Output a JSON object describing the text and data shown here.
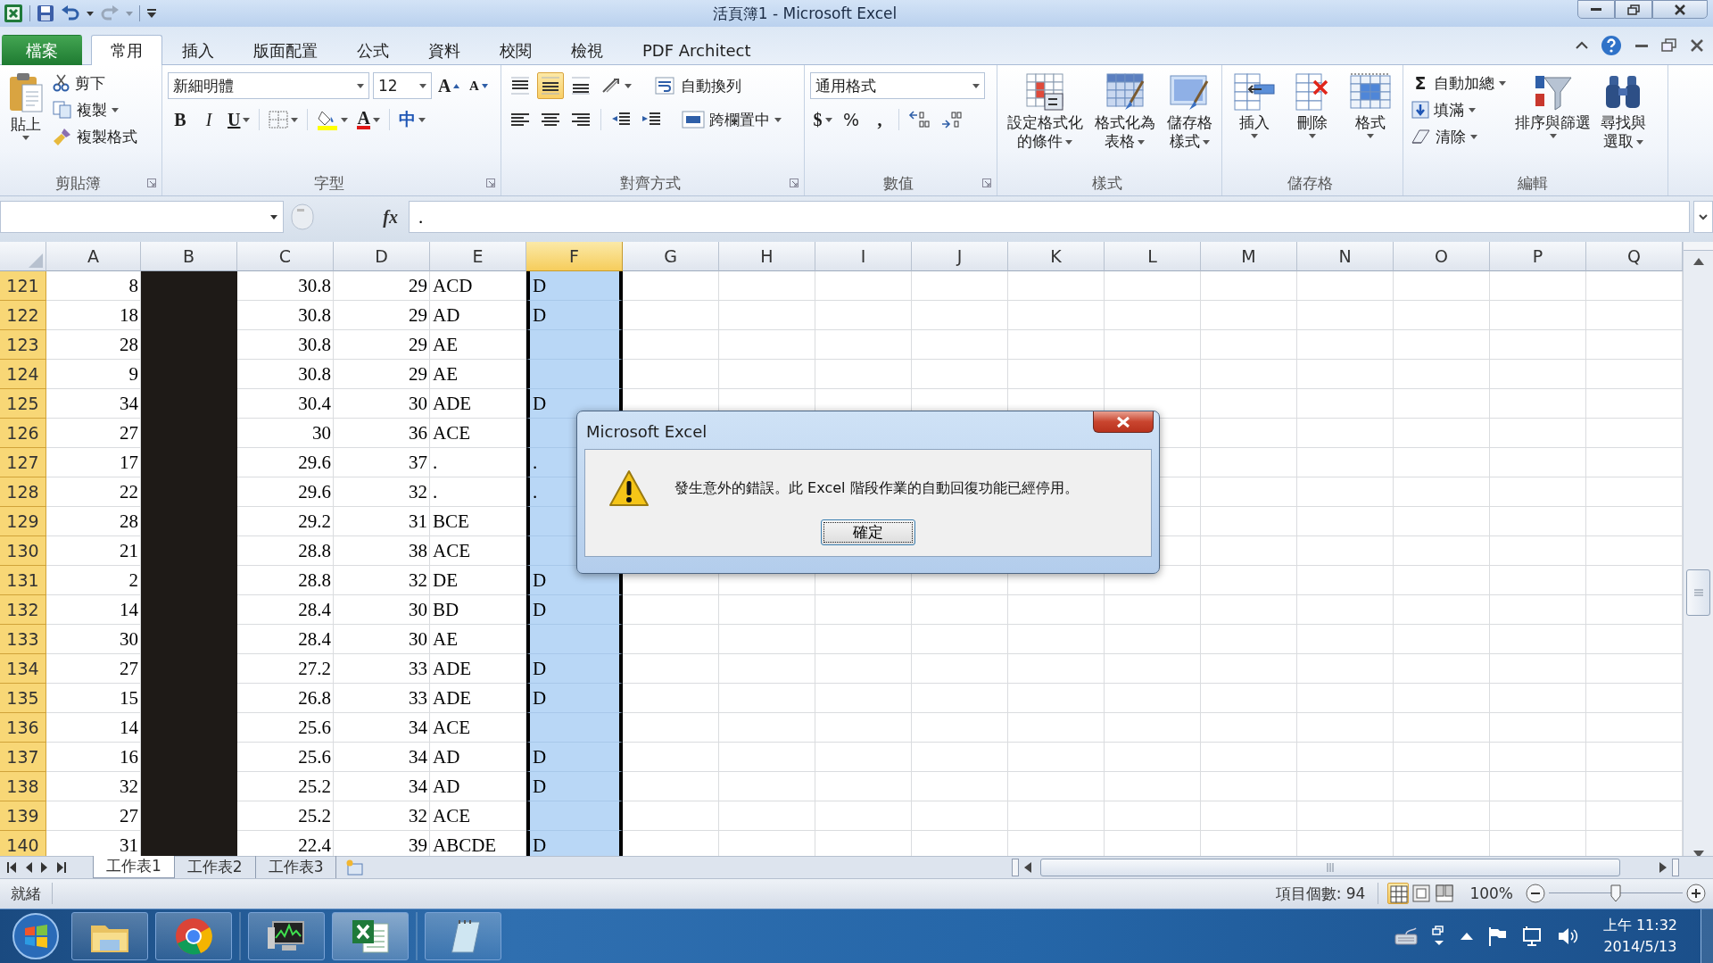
{
  "window": {
    "title": "活頁簿1 - Microsoft Excel"
  },
  "ribbon_tabs": [
    {
      "label": "檔案",
      "kind": "file",
      "selected": false
    },
    {
      "label": "常用",
      "kind": "tab",
      "selected": true
    },
    {
      "label": "插入",
      "kind": "tab",
      "selected": false
    },
    {
      "label": "版面配置",
      "kind": "tab",
      "selected": false
    },
    {
      "label": "公式",
      "kind": "tab",
      "selected": false
    },
    {
      "label": "資料",
      "kind": "tab",
      "selected": false
    },
    {
      "label": "校閱",
      "kind": "tab",
      "selected": false
    },
    {
      "label": "檢視",
      "kind": "tab",
      "selected": false
    },
    {
      "label": "PDF Architect",
      "kind": "tab",
      "selected": false
    }
  ],
  "clipboard": {
    "label": "剪貼簿",
    "paste": "貼上",
    "cut": "剪下",
    "copy": "複製",
    "format_painter": "複製格式"
  },
  "font": {
    "label": "字型",
    "name": "新細明體",
    "size": "12",
    "grow": "A",
    "shrink": "A",
    "bold": "B",
    "italic": "I",
    "underline": "U",
    "font_color": "A",
    "phonetic": "中"
  },
  "alignment": {
    "label": "對齊方式",
    "vertical": [
      {
        "kind": "top",
        "selected": false
      },
      {
        "kind": "middle",
        "selected": true
      },
      {
        "kind": "bottom",
        "selected": false
      }
    ],
    "wrap": "自動換列",
    "merge": "跨欄置中"
  },
  "number": {
    "label": "數值",
    "format": "通用格式",
    "currency": "$",
    "percent": "%",
    "comma": ","
  },
  "styles": {
    "label": "樣式",
    "buttons": [
      "設定格式化的條件",
      "格式化為表格",
      "儲存格樣式"
    ]
  },
  "cells": {
    "label": "儲存格",
    "buttons": [
      "插入",
      "刪除",
      "格式"
    ]
  },
  "editing": {
    "label": "編輯",
    "autosum_symbol": "Σ",
    "autosum": "自動加總",
    "fill": "填滿",
    "clear": "清除",
    "sort": "排序與篩選",
    "find": "尋找與選取"
  },
  "formula_bar": {
    "function_label": "fx",
    "value": "."
  },
  "sheet": {
    "columns": [
      {
        "label": "A",
        "selected": false
      },
      {
        "label": "B",
        "selected": false
      },
      {
        "label": "C",
        "selected": false
      },
      {
        "label": "D",
        "selected": false
      },
      {
        "label": "E",
        "selected": false
      },
      {
        "label": "F",
        "selected": true
      },
      {
        "label": "G",
        "selected": false
      },
      {
        "label": "H",
        "selected": false
      },
      {
        "label": "I",
        "selected": false
      },
      {
        "label": "J",
        "selected": false
      },
      {
        "label": "K",
        "selected": false
      },
      {
        "label": "L",
        "selected": false
      },
      {
        "label": "M",
        "selected": false
      },
      {
        "label": "N",
        "selected": false
      },
      {
        "label": "O",
        "selected": false
      },
      {
        "label": "P",
        "selected": false
      },
      {
        "label": "Q",
        "selected": false
      }
    ],
    "rows": [
      {
        "number": "121",
        "a": "8",
        "c": "30.8",
        "d": "29",
        "e": "ACD",
        "f": "D"
      },
      {
        "number": "122",
        "a": "18",
        "c": "30.8",
        "d": "29",
        "e": "AD",
        "f": "D"
      },
      {
        "number": "123",
        "a": "28",
        "c": "30.8",
        "d": "29",
        "e": "AE"
      },
      {
        "number": "124",
        "a": "9",
        "c": "30.8",
        "d": "29",
        "e": "AE"
      },
      {
        "number": "125",
        "a": "34",
        "c": "30.4",
        "d": "30",
        "e": "ADE",
        "f": "D"
      },
      {
        "number": "126",
        "a": "27",
        "c": "30",
        "d": "36",
        "e": "ACE"
      },
      {
        "number": "127",
        "a": "17",
        "c": "29.6",
        "d": "37",
        "e": ".",
        "f": "."
      },
      {
        "number": "128",
        "a": "22",
        "c": "29.6",
        "d": "32",
        "e": ".",
        "f": "."
      },
      {
        "number": "129",
        "a": "28",
        "c": "29.2",
        "d": "31",
        "e": "BCE"
      },
      {
        "number": "130",
        "a": "21",
        "c": "28.8",
        "d": "38",
        "e": "ACE"
      },
      {
        "number": "131",
        "a": "2",
        "c": "28.8",
        "d": "32",
        "e": "DE",
        "f": "D"
      },
      {
        "number": "132",
        "a": "14",
        "c": "28.4",
        "d": "30",
        "e": "BD",
        "f": "D"
      },
      {
        "number": "133",
        "a": "30",
        "c": "28.4",
        "d": "30",
        "e": "AE"
      },
      {
        "number": "134",
        "a": "27",
        "c": "27.2",
        "d": "33",
        "e": "ADE",
        "f": "D"
      },
      {
        "number": "135",
        "a": "15",
        "c": "26.8",
        "d": "33",
        "e": "ADE",
        "f": "D"
      },
      {
        "number": "136",
        "a": "14",
        "c": "25.6",
        "d": "34",
        "e": "ACE"
      },
      {
        "number": "137",
        "a": "16",
        "c": "25.6",
        "d": "34",
        "e": "AD",
        "f": "D"
      },
      {
        "number": "138",
        "a": "32",
        "c": "25.2",
        "d": "34",
        "e": "AD",
        "f": "D"
      },
      {
        "number": "139",
        "a": "27",
        "c": "25.2",
        "d": "32",
        "e": "ACE"
      },
      {
        "number": "140",
        "a": "31",
        "c": "22.4",
        "d": "39",
        "e": "ABCDE",
        "f": "D"
      }
    ]
  },
  "sheet_tabs": [
    {
      "label": "工作表1",
      "selected": true
    },
    {
      "label": "工作表2",
      "selected": false
    },
    {
      "label": "工作表3",
      "selected": false
    }
  ],
  "status_bar": {
    "ready": "就緒",
    "count": "項目個數: 94",
    "views": [
      {
        "kind": "normal",
        "selected": true
      },
      {
        "kind": "page_layout",
        "selected": false
      },
      {
        "kind": "page_break",
        "selected": false
      }
    ],
    "zoom": "100%",
    "zoom_slider": {
      "level": 0.5
    }
  },
  "taskbar": {
    "time": "上午 11:32",
    "date": "2014/5/13"
  },
  "dialog": {
    "title": "Microsoft Excel",
    "message": "發生意外的錯誤。此 Excel 階段作業的自動回復功能已經停用。",
    "button": "確定"
  }
}
